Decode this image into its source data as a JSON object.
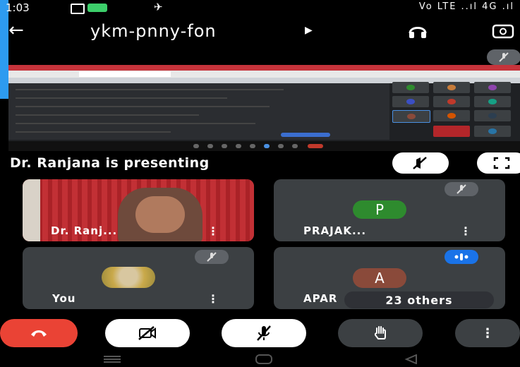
{
  "status_bar": {
    "time": "1:03",
    "right_indicators": "Vo LTE ..ıl 4G .ıl"
  },
  "header": {
    "meeting_code": "ykm-pnny-fon"
  },
  "presenting_label": "Dr. Ranjana is presenting",
  "participants": [
    {
      "name": "Dr. Ranj...",
      "kind": "video",
      "more": "⋮"
    },
    {
      "name": "PRAJAK...",
      "initial": "P",
      "avatar_color": "#2e8b2e",
      "muted": true,
      "more": "⋮"
    },
    {
      "name": "You",
      "kind": "photo",
      "muted": true,
      "more": "⋮"
    },
    {
      "name": "APAR",
      "initial": "A",
      "avatar_color": "#8a4a3a",
      "speaking": true
    }
  ],
  "others_label": "23 others",
  "controls": [
    "end-call",
    "camera-off",
    "mic-off",
    "raise-hand",
    "more-options"
  ],
  "colors": {
    "end_call": "#ea4335",
    "tile_bg": "#3c4043",
    "accent_blue": "#1a73e8"
  }
}
